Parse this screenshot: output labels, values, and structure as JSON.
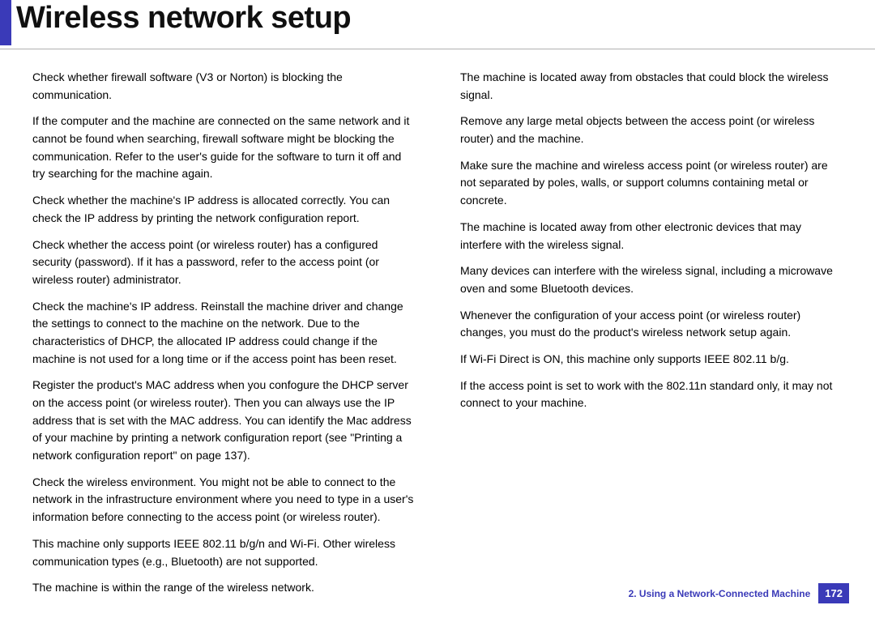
{
  "header": {
    "title": "Wireless network setup"
  },
  "left": {
    "p1": "Check whether firewall software (V3 or Norton) is blocking the communication.",
    "p2": "If the computer and the machine are connected on the same network and it cannot be found when searching, firewall software might be blocking the communication. Refer to the user's guide for the software to turn it off and try searching for the machine again.",
    "p3": "Check whether the machine's IP address is allocated correctly. You can check the IP address by printing the network configuration report.",
    "p4": "Check whether the access point (or wireless router) has a configured security (password). If it has a password, refer to the access point (or wireless router) administrator.",
    "p5": "Check the machine's IP address. Reinstall the machine driver and change the settings to connect to the machine on the network. Due to the characteristics of DHCP, the allocated IP address could change if the machine is not used for a long time or if the access point has been reset.",
    "p6": "Register the product's MAC address when you confogure the DHCP server on the access point (or wireless router). Then you can always use the IP address that is set with the MAC address. You can identify the Mac address of your machine by printing a network configuration report (see \"Printing a network configuration report\" on page 137).",
    "p7": "Check the wireless environment. You might not be able to connect to the network in the infrastructure environment where you need to type in a user's information before connecting to the access point (or wireless router).",
    "p8": "This machine only supports IEEE 802.11 b/g/n and Wi-Fi. Other wireless communication types (e.g., Bluetooth) are not supported.",
    "p9": "The machine is within the range of the wireless network."
  },
  "right": {
    "p1": "The machine is located away from obstacles that could block the wireless signal.",
    "p2": "Remove any large metal objects between the access point (or wireless router) and the machine.",
    "p3": "Make sure the machine and wireless access point (or wireless router) are not separated by poles, walls, or support columns containing metal or concrete.",
    "p4": "The machine is located away from other electronic devices that may interfere with the wireless signal.",
    "p5": "Many devices can interfere with the wireless signal, including a microwave oven and some Bluetooth devices.",
    "p6": "Whenever the configuration of your access point (or wireless router) changes, you must do the product's wireless network setup again.",
    "p7": "If Wi-Fi Direct is ON, this machine only supports IEEE 802.11 b/g.",
    "p8": "If the access point is set to work with the 802.11n standard only, it may not connect to your machine."
  },
  "footer": {
    "chapter": "2.  Using a Network-Connected Machine",
    "page": "172"
  }
}
